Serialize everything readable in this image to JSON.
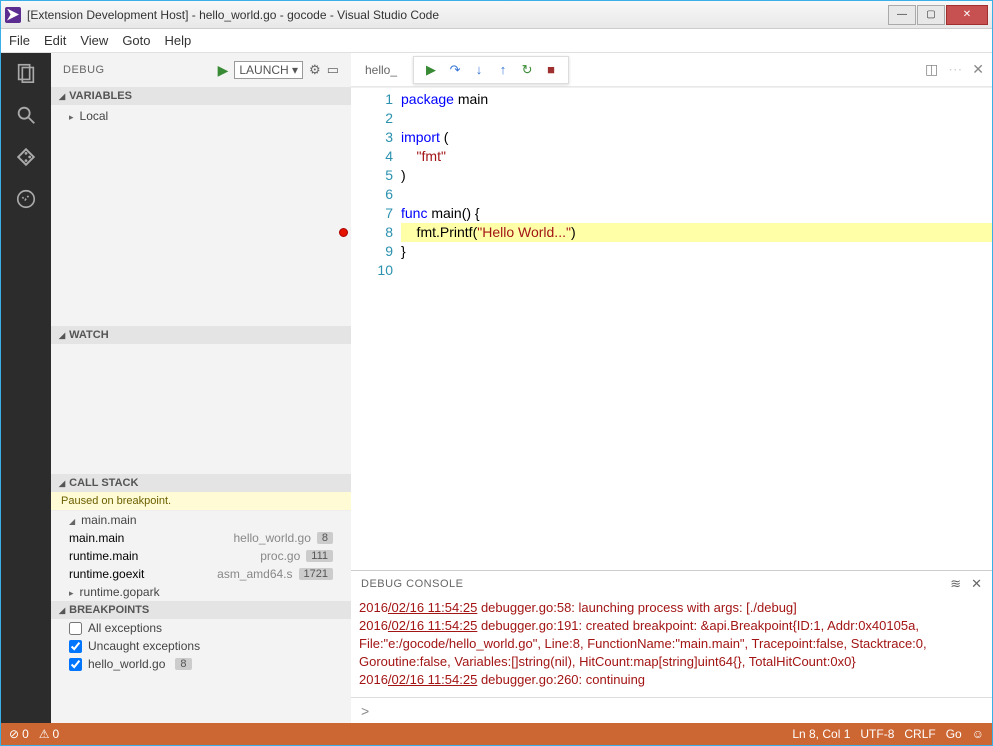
{
  "window": {
    "title": "[Extension Development Host] - hello_world.go - gocode - Visual Studio Code"
  },
  "menu": [
    "File",
    "Edit",
    "View",
    "Goto",
    "Help"
  ],
  "debug": {
    "label": "DEBUG",
    "launch": "Launch ▾",
    "sections": {
      "variables": "VARIABLES",
      "local": "Local",
      "watch": "WATCH",
      "callstack": "CALL STACK",
      "paused": "Paused on breakpoint.",
      "breakpoints": "BREAKPOINTS"
    },
    "stack_top": "main.main",
    "frames": [
      {
        "fn": "main.main",
        "file": "hello_world.go",
        "line": "8"
      },
      {
        "fn": "runtime.main",
        "file": "proc.go",
        "line": "111"
      },
      {
        "fn": "runtime.goexit",
        "file": "asm_amd64.s",
        "line": "1721"
      }
    ],
    "stack_collapsed": "runtime.gopark",
    "bps": [
      {
        "label": "All exceptions",
        "checked": false
      },
      {
        "label": "Uncaught exceptions",
        "checked": true
      },
      {
        "label": "hello_world.go",
        "checked": true,
        "line": "8"
      }
    ]
  },
  "tab": "hello_",
  "code": {
    "lines": [
      {
        "n": 1,
        "seg": [
          {
            "t": "package ",
            "c": "kw"
          },
          {
            "t": "main",
            "c": "pkg"
          }
        ]
      },
      {
        "n": 2,
        "seg": []
      },
      {
        "n": 3,
        "seg": [
          {
            "t": "import ",
            "c": "kw"
          },
          {
            "t": "(",
            "c": "punc"
          }
        ]
      },
      {
        "n": 4,
        "seg": [
          {
            "t": "    \"fmt\"",
            "c": "str"
          }
        ]
      },
      {
        "n": 5,
        "seg": [
          {
            "t": ")",
            "c": "punc"
          }
        ]
      },
      {
        "n": 6,
        "seg": []
      },
      {
        "n": 7,
        "seg": [
          {
            "t": "func ",
            "c": "kw"
          },
          {
            "t": "main() {",
            "c": "fn"
          }
        ]
      },
      {
        "n": 8,
        "hl": true,
        "bp": true,
        "seg": [
          {
            "t": "    fmt.Printf(",
            "c": "fn"
          },
          {
            "t": "\"Hello World...\"",
            "c": "str"
          },
          {
            "t": ")",
            "c": "punc"
          }
        ]
      },
      {
        "n": 9,
        "seg": [
          {
            "t": "}",
            "c": "punc"
          }
        ]
      },
      {
        "n": 10,
        "seg": []
      }
    ]
  },
  "console": {
    "title": "DEBUG CONSOLE",
    "lines": [
      {
        "ts": "2016/02/16 11:54:25",
        "txt": " debugger.go:58: launching process with args: [./debug]"
      },
      {
        "ts": "2016/02/16 11:54:25",
        "txt": " debugger.go:191: created breakpoint: &api.Breakpoint{ID:1, Addr:0x40105a, File:\"e:/gocode/hello_world.go\", Line:8, FunctionName:\"main.main\", Tracepoint:false, Stacktrace:0, Goroutine:false, Variables:[]string(nil), HitCount:map[string]uint64{}, TotalHitCount:0x0}"
      },
      {
        "ts": "2016/02/16 11:54:25",
        "txt": " debugger.go:260: continuing"
      }
    ],
    "prompt": ">"
  },
  "status": {
    "errors": "0",
    "warnings": "0",
    "pos": "Ln 8, Col 1",
    "enc": "UTF-8",
    "eol": "CRLF",
    "lang": "Go",
    "smile": "☺"
  }
}
